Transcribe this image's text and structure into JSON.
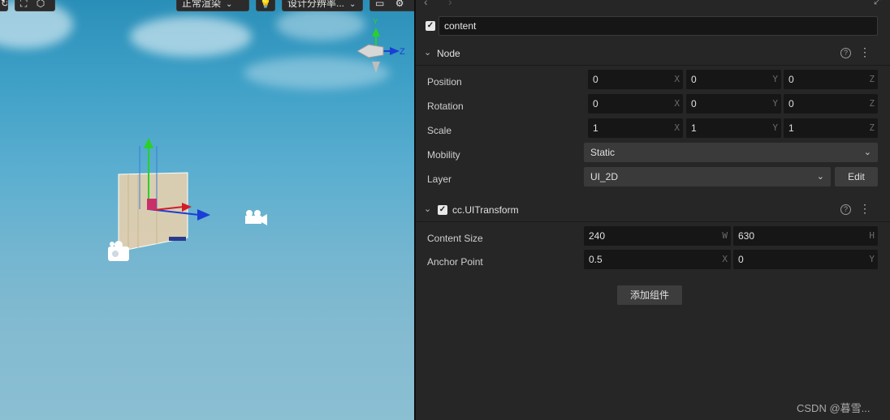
{
  "scene_toolbar": {
    "render_mode": "正常渲染",
    "resolution": "设计分辨率..."
  },
  "gizmo": {
    "y_axis": "Y",
    "z_axis": "Z"
  },
  "node_header": {
    "checked": true,
    "name": "content"
  },
  "node_section": {
    "title": "Node",
    "position": {
      "label": "Position",
      "x": "0",
      "y": "0",
      "z": "0"
    },
    "rotation": {
      "label": "Rotation",
      "x": "0",
      "y": "0",
      "z": "0"
    },
    "scale": {
      "label": "Scale",
      "x": "1",
      "y": "1",
      "z": "1"
    },
    "mobility": {
      "label": "Mobility",
      "value": "Static"
    },
    "layer": {
      "label": "Layer",
      "value": "UI_2D",
      "edit_label": "Edit"
    }
  },
  "uitransform_section": {
    "checked": true,
    "title": "cc.UITransform",
    "content_size": {
      "label": "Content Size",
      "w": "240",
      "h": "630"
    },
    "anchor_point": {
      "label": "Anchor Point",
      "x": "0.5",
      "y": "0"
    }
  },
  "axis_labels": {
    "x": "X",
    "y": "Y",
    "z": "Z",
    "w": "W",
    "h": "H"
  },
  "add_component_label": "添加组件",
  "watermark": "CSDN @暮雪...",
  "colors": {
    "accent_green": "#2ad12a",
    "accent_red": "#d11d2a",
    "accent_blue": "#1a3fd6",
    "inspector_bg": "#262626"
  }
}
